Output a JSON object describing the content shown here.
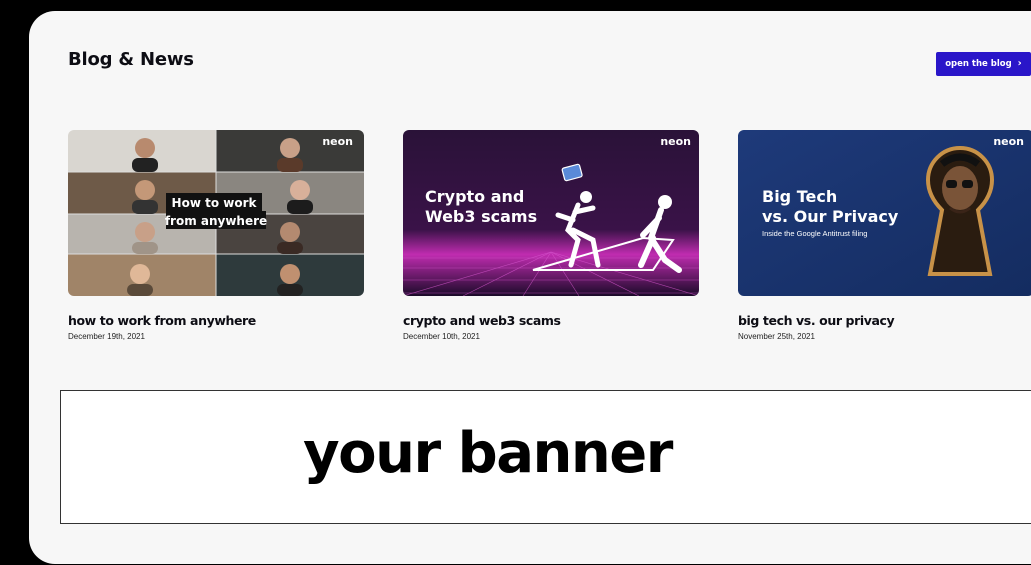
{
  "section": {
    "title": "Blog & News",
    "open_blog_label": "open the blog",
    "open_blog_icon": "chevron-right-icon"
  },
  "colors": {
    "accent": "#2a16c9",
    "panel_bg": "#f7f7f7",
    "page_bg": "#000000"
  },
  "posts": [
    {
      "thumb_brand": "neon",
      "thumb_headline_1": "How to work",
      "thumb_headline_2": "from anywhere",
      "title": "how to work from anywhere",
      "date": "December 19th, 2021"
    },
    {
      "thumb_brand": "neon",
      "thumb_headline_1": "Crypto and",
      "thumb_headline_2": "Web3 scams",
      "title": "crypto and web3 scams",
      "date": "December 10th, 2021"
    },
    {
      "thumb_brand": "neon",
      "thumb_headline_1": "Big Tech",
      "thumb_headline_2": "vs. Our Privacy",
      "thumb_subline": "Inside the Google Antitrust filing",
      "title": "big tech vs. our privacy",
      "date": "November 25th, 2021"
    }
  ],
  "banner": {
    "text": "your banner"
  }
}
